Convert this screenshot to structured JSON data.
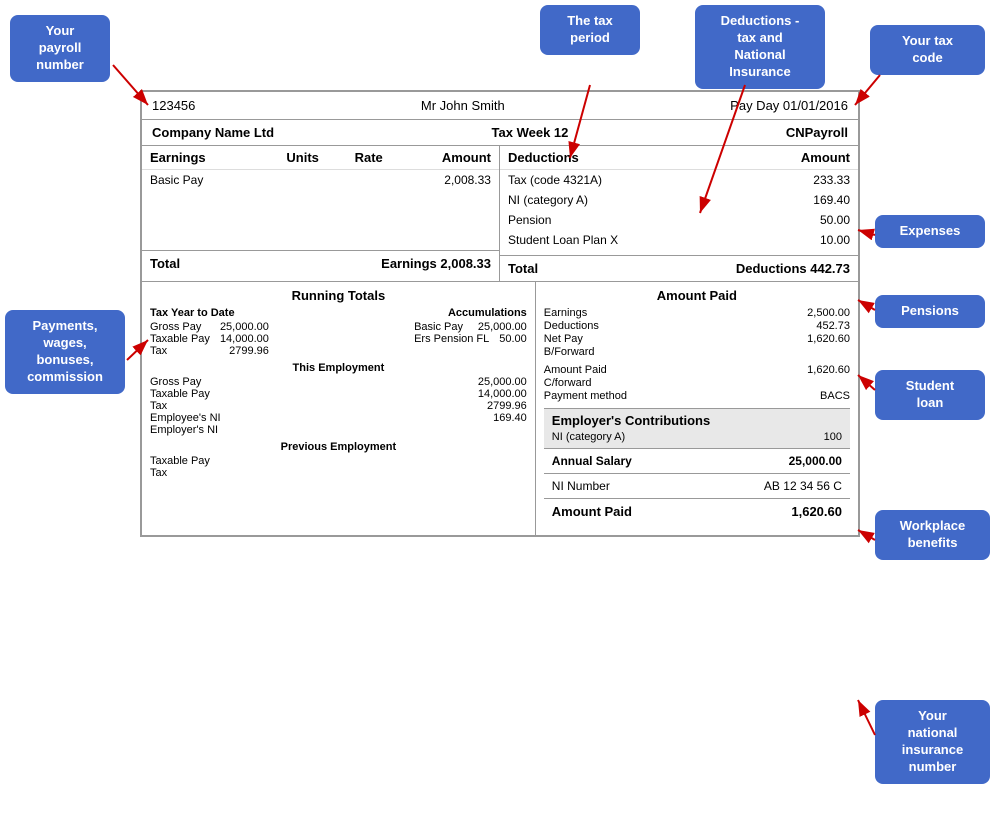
{
  "callouts": {
    "payroll_number": "Your\npayroll\nnumber",
    "tax_period": "The tax\nperiod",
    "deductions_tax": "Deductions -\ntax and\nNational\nInsurance",
    "your_tax_code": "Your tax\ncode",
    "expenses": "Expenses",
    "pensions": "Pensions",
    "student_loan": "Student\nloan",
    "payments_wages": "Payments,\nwages,\nbonuses,\ncommission",
    "workplace_benefits": "Workplace\nbenefits",
    "national_insurance": "Your\nnational\ninsurance\nnumber"
  },
  "header": {
    "payroll_id": "123456",
    "employee_name": "Mr John Smith",
    "pay_date": "Pay Day 01/01/2016"
  },
  "company": {
    "name": "Company Name Ltd",
    "tax_week": "Tax Week 12",
    "payroll_software": "CNPayroll"
  },
  "earnings": {
    "col_earnings": "Earnings",
    "col_units": "Units",
    "col_rate": "Rate",
    "col_amount": "Amount",
    "rows": [
      {
        "description": "Basic Pay",
        "units": "",
        "rate": "",
        "amount": "2,008.33"
      }
    ],
    "total_label": "Total",
    "total_earnings_label": "Earnings",
    "total_amount": "2,008.33"
  },
  "deductions": {
    "col_deductions": "Deductions",
    "col_amount": "Amount",
    "rows": [
      {
        "description": "Tax (code 4321A)",
        "amount": "233.33"
      },
      {
        "description": "NI (category A)",
        "amount": "169.40"
      },
      {
        "description": "Pension",
        "amount": "50.00"
      },
      {
        "description": "Student Loan Plan X",
        "amount": "10.00"
      }
    ],
    "total_label": "Total",
    "total_deductions_label": "Deductions",
    "total_amount": "442.73"
  },
  "running_totals": {
    "title": "Running Totals",
    "tax_year_label": "Tax Year to Date",
    "accumulations_label": "Accumulations",
    "tax_year_rows": [
      {
        "label": "Gross Pay",
        "value": "25,000.00"
      },
      {
        "label": "Taxable Pay",
        "value": "14,000.00"
      },
      {
        "label": "Tax",
        "value": "2799.96"
      }
    ],
    "accumulations_rows": [
      {
        "label": "Basic Pay",
        "value": "25,000.00"
      },
      {
        "label": "Ers Pension FL",
        "value": "50.00"
      }
    ],
    "this_employment_label": "This Employment",
    "this_employment_rows": [
      {
        "label": "Gross Pay",
        "value": "25,000.00"
      },
      {
        "label": "Taxable Pay",
        "value": "14,000.00"
      },
      {
        "label": "Tax",
        "value": "2799.96"
      },
      {
        "label": "Employee's NI",
        "value": "169.40"
      },
      {
        "label": "Employer's NI",
        "value": ""
      }
    ],
    "previous_employment_label": "Previous Employment",
    "previous_employment_rows": [
      {
        "label": "Taxable Pay",
        "value": ""
      },
      {
        "label": "Tax",
        "value": ""
      }
    ]
  },
  "amount_paid": {
    "title": "Amount Paid",
    "rows": [
      {
        "label": "Earnings",
        "value": "2,500.00"
      },
      {
        "label": "Deductions",
        "value": "452.73"
      },
      {
        "label": "Net Pay",
        "value": "1,620.60"
      },
      {
        "label": "B/Forward",
        "value": ""
      }
    ],
    "rows2": [
      {
        "label": "Amount Paid",
        "value": "1,620.60"
      },
      {
        "label": "C/forward",
        "value": ""
      },
      {
        "label": "Payment method",
        "value": "BACS"
      }
    ]
  },
  "employer_contributions": {
    "title": "Employer's Contributions",
    "rows": [
      {
        "label": "NI (category A)",
        "value": "100"
      }
    ]
  },
  "annual_salary": {
    "label": "Annual Salary",
    "value": "25,000.00"
  },
  "ni_number": {
    "label": "NI Number",
    "value": "AB 12 34 56 C"
  },
  "amount_paid_total": {
    "label": "Amount Paid",
    "value": "1,620.60"
  }
}
